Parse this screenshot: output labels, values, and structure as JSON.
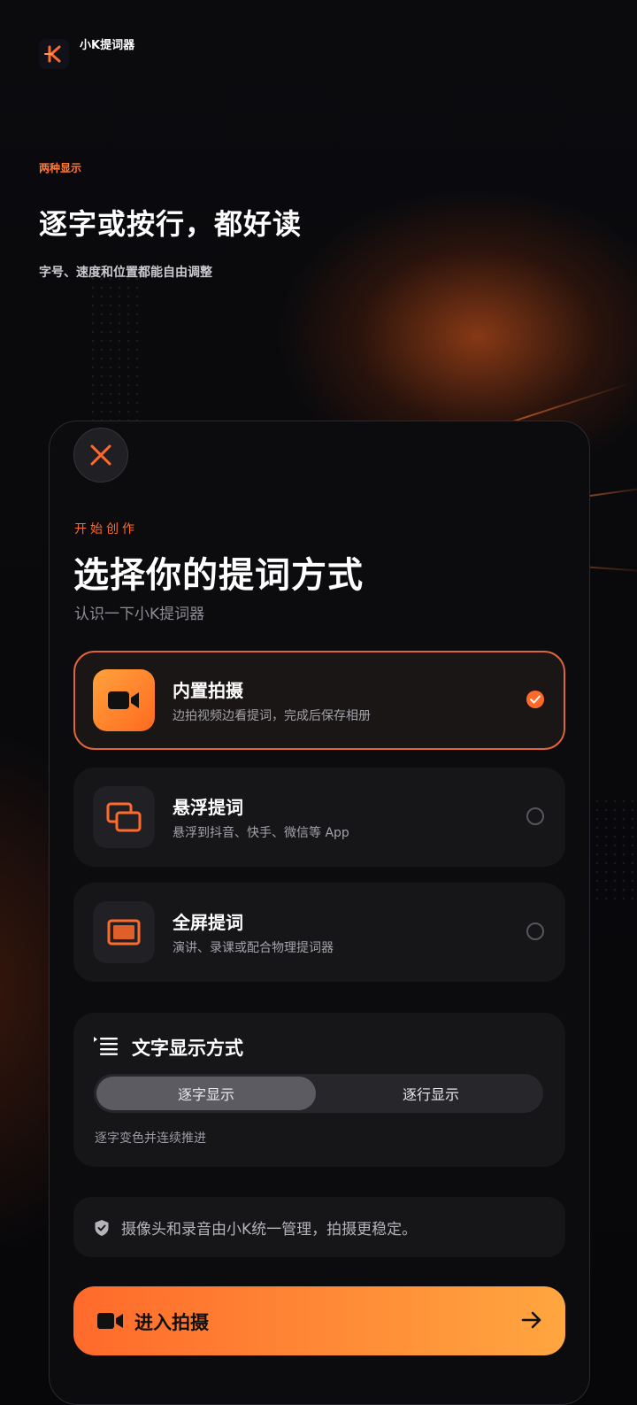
{
  "app": {
    "name": "小K提词器",
    "logo_icon": "k-logo-icon"
  },
  "intro": {
    "eyebrow": "两种显示",
    "headline": "逐字或按行，都好读",
    "subline": "字号、速度和位置都能自由调整"
  },
  "sheet": {
    "close_icon": "close-icon",
    "eyebrow": "开始创作",
    "title": "选择你的提词方式",
    "subtitle": "认识一下小K提词器",
    "options": [
      {
        "icon": "video-camera-icon",
        "title": "内置拍摄",
        "desc": "边拍视频边看提词，完成后保存相册",
        "selected": true
      },
      {
        "icon": "floating-windows-icon",
        "title": "悬浮提词",
        "desc": "悬浮到抖音、快手、微信等 App",
        "selected": false
      },
      {
        "icon": "fullscreen-icon",
        "title": "全屏提词",
        "desc": "演讲、录课或配合物理提词器",
        "selected": false
      }
    ],
    "text_mode": {
      "icon": "text-list-icon",
      "title": "文字显示方式",
      "segments": [
        "逐字显示",
        "逐行显示"
      ],
      "selected": "逐字显示",
      "note": "逐字变色并连续推进"
    },
    "notice": {
      "icon": "shield-check-icon",
      "text": "摄像头和录音由小K统一管理，拍摄更稳定。"
    },
    "cta": {
      "icon": "video-camera-icon",
      "label": "进入拍摄",
      "arrow_icon": "arrow-right-icon"
    }
  },
  "colors": {
    "accent": "#ff6a2b",
    "accent_light": "#ffa640",
    "background": "#07070a",
    "card": "#161619"
  }
}
